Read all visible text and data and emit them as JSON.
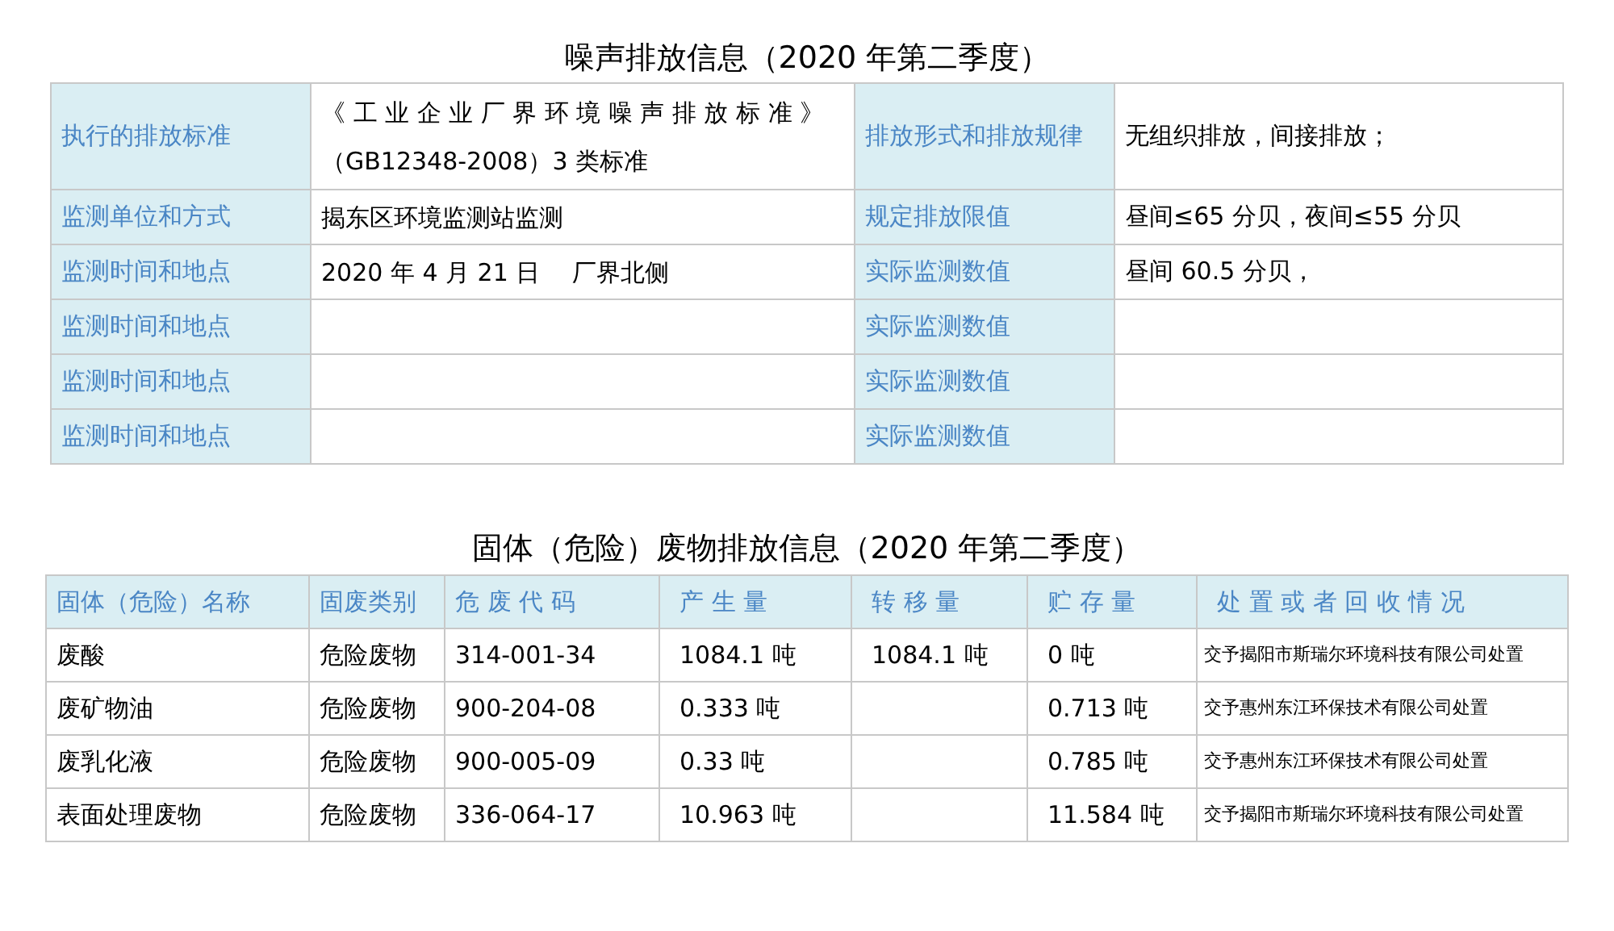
{
  "noise": {
    "title": "噪声排放信息（2020 年第二季度）",
    "rows": [
      {
        "label": "执行的排放标准",
        "value": [
          "《 工 业 企 业 厂 界 环 境 噪 声 排 放 标 准 》",
          "（GB12348-2008）3 类标准"
        ],
        "label_2": "排放形式和排放规律",
        "value_2": "无组织排放，间接排放；"
      },
      {
        "label": "监测单位和方式",
        "value": [
          "揭东区环境监测站监测"
        ],
        "label_2": "规定排放限值",
        "value_2": "昼间≤65 分贝，夜间≤55 分贝"
      },
      {
        "label": "监测时间和地点",
        "value": [
          "2020 年 4 月 21 日　  厂界北侧"
        ],
        "label_2": "实际监测数值",
        "value_2": "昼间 60.5 分贝，"
      },
      {
        "label": "监测时间和地点",
        "label_2": "实际监测数值"
      },
      {
        "label": "监测时间和地点",
        "label_2": "实际监测数值"
      },
      {
        "label": "监测时间和地点",
        "label_2": "实际监测数值"
      }
    ]
  },
  "waste": {
    "title": "固体（危险）废物排放信息（2020 年第二季度）",
    "columns": [
      "固体（危险）名称",
      "固废类别",
      "危 废 代 码",
      "产 生 量",
      "转 移 量",
      "贮 存 量",
      "处 置 或 者 回 收 情 况"
    ],
    "rows": [
      {
        "name": "废酸",
        "category": "危险废物",
        "code": "314-001-34",
        "produced": "1084.1 吨",
        "transferred": "1084.1 吨",
        "stored": "0 吨",
        "disposal": "交予揭阳市斯瑞尔环境科技有限公司处置"
      },
      {
        "name": "废矿物油",
        "category": "危险废物",
        "code": "900-204-08",
        "produced": "0.333 吨",
        "stored": "0.713 吨",
        "disposal": "交予惠州东江环保技术有限公司处置"
      },
      {
        "name": "废乳化液",
        "category": "危险废物",
        "code": "900-005-09",
        "produced": "0.33 吨",
        "stored": "0.785 吨",
        "disposal": "交予惠州东江环保技术有限公司处置"
      },
      {
        "name": "表面处理废物",
        "category": "危险废物",
        "code": "336-064-17",
        "produced": "10.963 吨",
        "stored": "11.584 吨",
        "disposal": "交予揭阳市斯瑞尔环境科技有限公司处置"
      }
    ]
  }
}
